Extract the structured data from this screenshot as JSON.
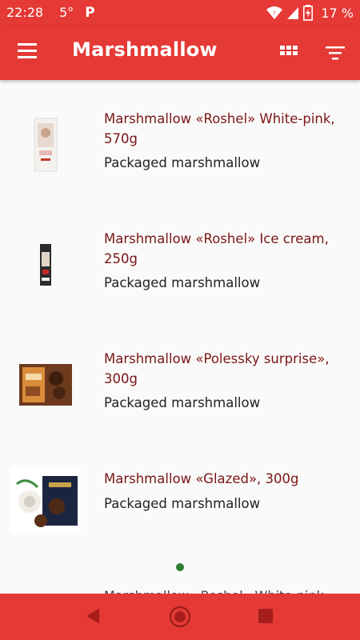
{
  "status_bar": {
    "time": "22:28",
    "temperature": "5°",
    "parking_label": "P",
    "battery": "17 %"
  },
  "app_bar": {
    "title": "Marshmallow",
    "menu_icon": "hamburger-menu-icon",
    "grid_icon": "grid-view-icon",
    "filter_icon": "sort-filter-icon"
  },
  "products": [
    {
      "title": "Marshmallow «Roshel» White-pink, 570g",
      "category": "Packaged marshmallow"
    },
    {
      "title": "Marshmallow «Roshel» Ice cream, 250g",
      "category": "Packaged marshmallow"
    },
    {
      "title": "Marshmallow «Polessky surprise», 300g",
      "category": "Packaged marshmallow"
    },
    {
      "title": "Marshmallow «Glazed», 300g",
      "category": "Packaged marshmallow"
    }
  ],
  "clipped_next_title": "Marshmallow «Roshel» White-pink",
  "colors": {
    "primary": "#e53935",
    "title_text": "#7b1515",
    "page_indicator": "#2e7d32"
  }
}
